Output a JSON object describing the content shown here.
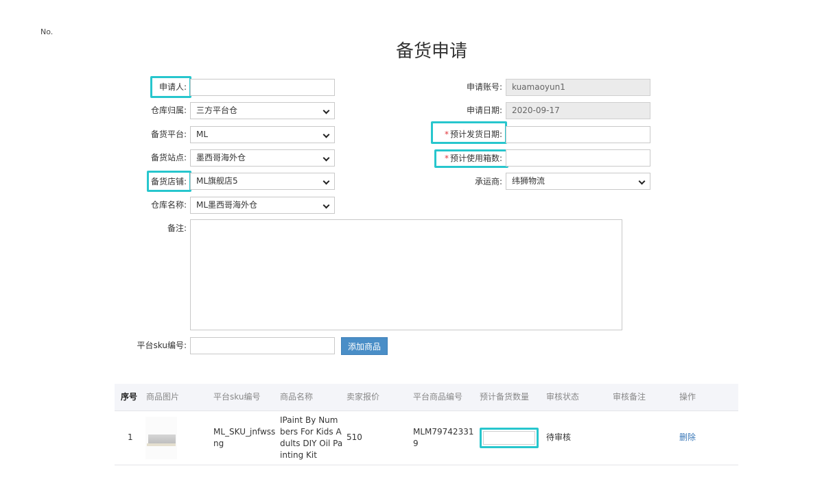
{
  "doc_no_label": "No.",
  "title": "备货申请",
  "form": {
    "applicant": {
      "label": "申请人:",
      "value": ""
    },
    "warehouse_owner": {
      "label": "仓库归属:",
      "value": "三方平台仓"
    },
    "platform": {
      "label": "备货平台:",
      "value": "ML"
    },
    "site": {
      "label": "备货站点:",
      "value": "墨西哥海外仓"
    },
    "store": {
      "label": "备货店铺:",
      "value": "ML旗舰店5"
    },
    "warehouse_name": {
      "label": "仓库名称:",
      "value": "ML墨西哥海外仓"
    },
    "account": {
      "label": "申请账号:",
      "value": "kuamaoyun1"
    },
    "apply_date": {
      "label": "申请日期:",
      "value": "2020-09-17"
    },
    "ship_date": {
      "required_mark": "*",
      "label": "预计发货日期:",
      "value": ""
    },
    "box_count": {
      "required_mark": "*",
      "label": "预计使用箱数:",
      "value": ""
    },
    "carrier": {
      "label": "承运商:",
      "value": "纬狮物流"
    },
    "remark": {
      "label": "备注:",
      "value": ""
    },
    "sku": {
      "label": "平台sku编号:",
      "value": ""
    },
    "add_button": "添加商品"
  },
  "table": {
    "headers": [
      "序号",
      "商品图片",
      "平台sku编号",
      "商品名称",
      "卖家报价",
      "平台商品编号",
      "预计备货数量",
      "审核状态",
      "审核备注",
      "操作"
    ],
    "rows": [
      {
        "index": "1",
        "sku_line1": "ML_SKU_jnfwss",
        "sku_line2": "ng",
        "name_line1": "IPaint By Num",
        "name_line2": "bers For Kids A",
        "name_line3": "dults DIY Oil Pa",
        "name_line4": "inting Kit",
        "price": "510",
        "platform_no_line1": "MLM79742331",
        "platform_no_line2": "9",
        "qty": "",
        "status": "待审核",
        "audit_remark": "",
        "action": "删除"
      }
    ]
  },
  "colors": {
    "highlight": "#27c6cd",
    "primary_button": "#4a8ec7",
    "required": "#e0353b",
    "link": "#3a78b8"
  }
}
